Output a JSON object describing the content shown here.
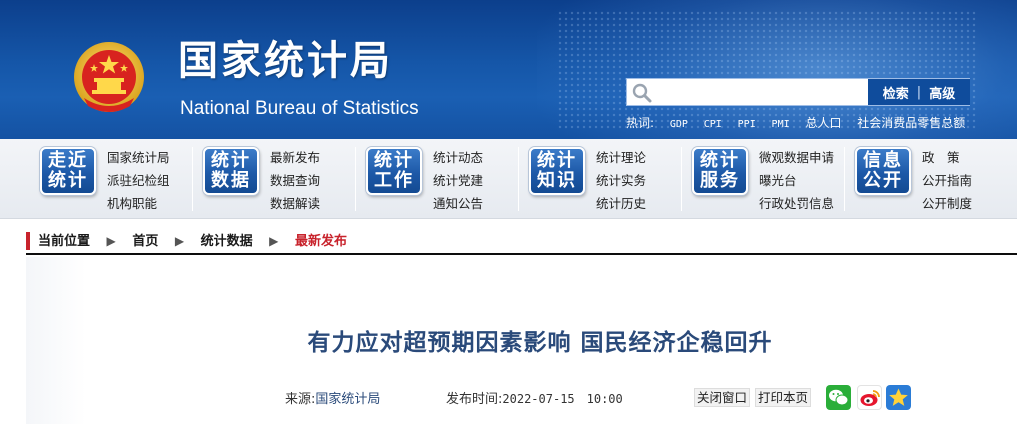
{
  "header": {
    "title": "国家统计局",
    "subtitle": "National Bureau of Statistics",
    "search": {
      "placeholder": "",
      "search_label": "检索",
      "separator": "|",
      "advanced_label": "高级"
    },
    "hotwords_label": "热词:",
    "hotwords": [
      "GDP",
      "CPI",
      "PPI",
      "PMI",
      "总人口",
      "社会消费品零售总额"
    ]
  },
  "nav": [
    {
      "badge_top": "走近",
      "badge_bottom": "统计",
      "links": [
        "国家统计局",
        "派驻纪检组",
        "机构职能"
      ]
    },
    {
      "badge_top": "统计",
      "badge_bottom": "数据",
      "links": [
        "最新发布",
        "数据查询",
        "数据解读"
      ]
    },
    {
      "badge_top": "统计",
      "badge_bottom": "工作",
      "links": [
        "统计动态",
        "统计党建",
        "通知公告"
      ]
    },
    {
      "badge_top": "统计",
      "badge_bottom": "知识",
      "links": [
        "统计理论",
        "统计实务",
        "统计历史"
      ]
    },
    {
      "badge_top": "统计",
      "badge_bottom": "服务",
      "links": [
        "微观数据申请",
        "曝光台",
        "行政处罚信息"
      ]
    },
    {
      "badge_top": "信息",
      "badge_bottom": "公开",
      "links": [
        "政　策",
        "公开指南",
        "公开制度"
      ]
    }
  ],
  "breadcrumb": {
    "label": "当前位置",
    "items": [
      "首页",
      "统计数据",
      "最新发布"
    ],
    "arrow": "▶"
  },
  "article": {
    "title": "有力应对超预期因素影响 国民经济企稳回升",
    "source_label": "来源:",
    "source_value": "国家统计局",
    "time_label": "发布时间:",
    "time_value": "2022-07-15　10:00",
    "close_label": "关闭窗口",
    "print_label": "打印本页"
  },
  "share": [
    "wechat-icon",
    "weibo-icon",
    "qzone-icon"
  ],
  "colors": {
    "header_blue": "#1556a8",
    "accent_red": "#c8232c",
    "title_blue": "#2a4a7a"
  }
}
